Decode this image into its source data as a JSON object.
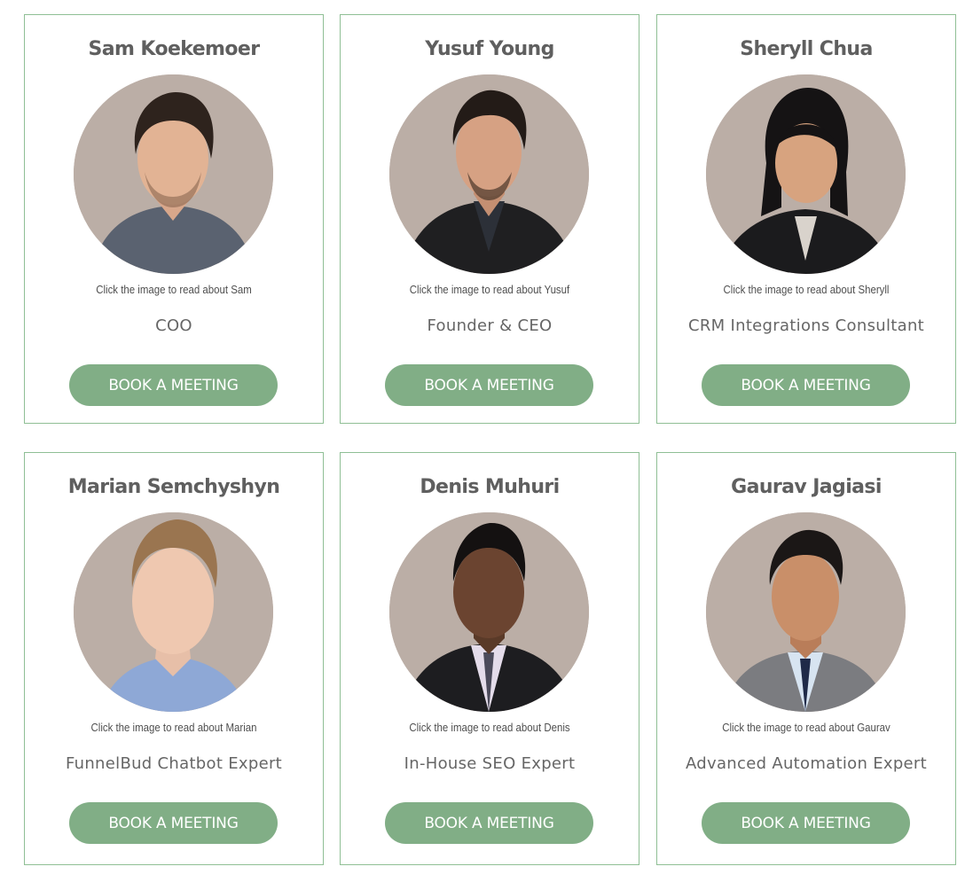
{
  "colors": {
    "accent": "#81ae86",
    "border": "#8fbf95",
    "photo_bg": "#bbaea6"
  },
  "team": [
    {
      "name": "Sam Koekemoer",
      "hint": "Click the image to read about Sam",
      "role": "COO",
      "button": "BOOK A MEETING"
    },
    {
      "name": "Yusuf Young",
      "hint": "Click the image to read about Yusuf",
      "role": "Founder & CEO",
      "button": "BOOK A MEETING"
    },
    {
      "name": "Sheryll Chua",
      "hint": "Click the image to read about Sheryll",
      "role": "CRM Integrations Consultant",
      "button": "BOOK A MEETING"
    },
    {
      "name": "Marian Semchyshyn",
      "hint": "Click the image to read about Marian",
      "role": "FunnelBud Chatbot Expert",
      "button": "BOOK A MEETING"
    },
    {
      "name": "Denis Muhuri",
      "hint": "Click the image to read about Denis",
      "role": "In-House SEO Expert",
      "button": "BOOK A MEETING"
    },
    {
      "name": "Gaurav Jagiasi",
      "hint": "Click the image to read about Gaurav",
      "role": "Advanced Automation Expert",
      "button": "BOOK A MEETING"
    }
  ]
}
